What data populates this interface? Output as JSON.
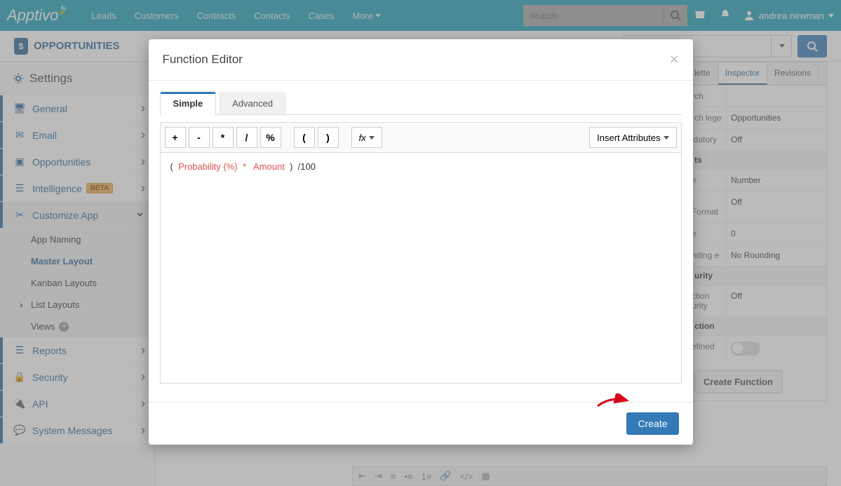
{
  "nav": {
    "brand": "Apptivo",
    "links": [
      "Leads",
      "Customers",
      "Contracts",
      "Contacts",
      "Cases",
      "More"
    ],
    "search_placeholder": "search",
    "user": "andrea newman"
  },
  "app": {
    "title": "OPPORTUNITIES"
  },
  "sidebar": {
    "header": "Settings",
    "items": [
      {
        "label": "General"
      },
      {
        "label": "Email"
      },
      {
        "label": "Opportunities"
      },
      {
        "label": "Intelligence",
        "badge": "BETA"
      },
      {
        "label": "Customize App",
        "expanded": true,
        "children": [
          {
            "label": "App Naming"
          },
          {
            "label": "Master Layout",
            "active": true
          },
          {
            "label": "Kanban Layouts"
          },
          {
            "label": "List Layouts",
            "chev": true
          },
          {
            "label": "Views",
            "plus": true
          }
        ]
      },
      {
        "label": "Reports"
      },
      {
        "label": "Security"
      },
      {
        "label": "API"
      },
      {
        "label": "System Messages"
      }
    ]
  },
  "inspector": {
    "tabs": {
      "t1": "lette",
      "t2": "Inspector",
      "t3": "Revisions"
    },
    "rows": [
      {
        "k": "rch",
        "v": ""
      },
      {
        "k": "rch lege",
        "v": "Opportunities"
      },
      {
        "k": "idatory",
        "v": "Off"
      }
    ],
    "sect2": "ts",
    "rows2": [
      {
        "k": "e",
        "v": "Number"
      },
      {
        "k": "t Format",
        "v": "Off"
      },
      {
        "k": "e",
        "v": "0"
      },
      {
        "k": "nding e",
        "v": "No Rounding"
      }
    ],
    "sect3": "urity",
    "rows3": [
      {
        "k": "ction urity",
        "v": "Off"
      }
    ],
    "sect4": "ction",
    "defined_label": "efined",
    "create_fn": "Create Function"
  },
  "modal": {
    "title": "Function Editor",
    "tabs": {
      "simple": "Simple",
      "advanced": "Advanced"
    },
    "ops": {
      "plus": "+",
      "minus": "-",
      "mult": "*",
      "div": "/",
      "pct": "%",
      "lp": "(",
      "rp": ")",
      "fx": "fx"
    },
    "insert_attr": "Insert Attributes",
    "expr": {
      "lp": "(",
      "a": "Probability (%)",
      "op": "*",
      "b": "Amount",
      "rp": ")",
      "tail": "/100"
    },
    "create": "Create"
  }
}
